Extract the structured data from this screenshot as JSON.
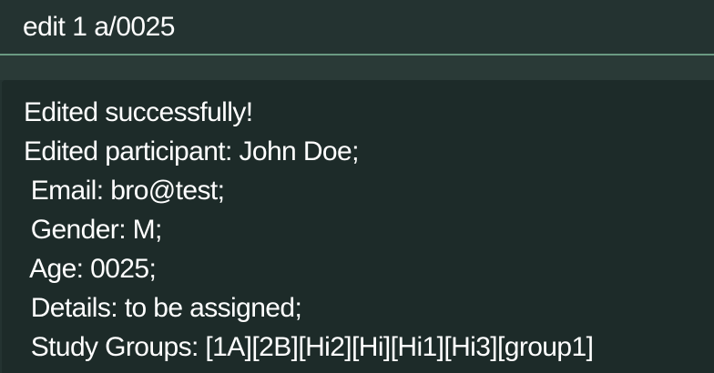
{
  "command_box": {
    "value": "edit 1 a/0025"
  },
  "result_display": {
    "lines": [
      "Edited successfully!",
      "Edited participant: John Doe;",
      " Email: bro@test;",
      " Gender: M;",
      " Age: 0025;",
      " Details: to be assigned;",
      " Study Groups: [1A][2B][Hi2][Hi][Hi1][Hi3][group1]"
    ]
  },
  "colors": {
    "background": "#243331",
    "result_background": "#1d2b29",
    "divider": "#6a9a82",
    "text": "#ffffff"
  }
}
